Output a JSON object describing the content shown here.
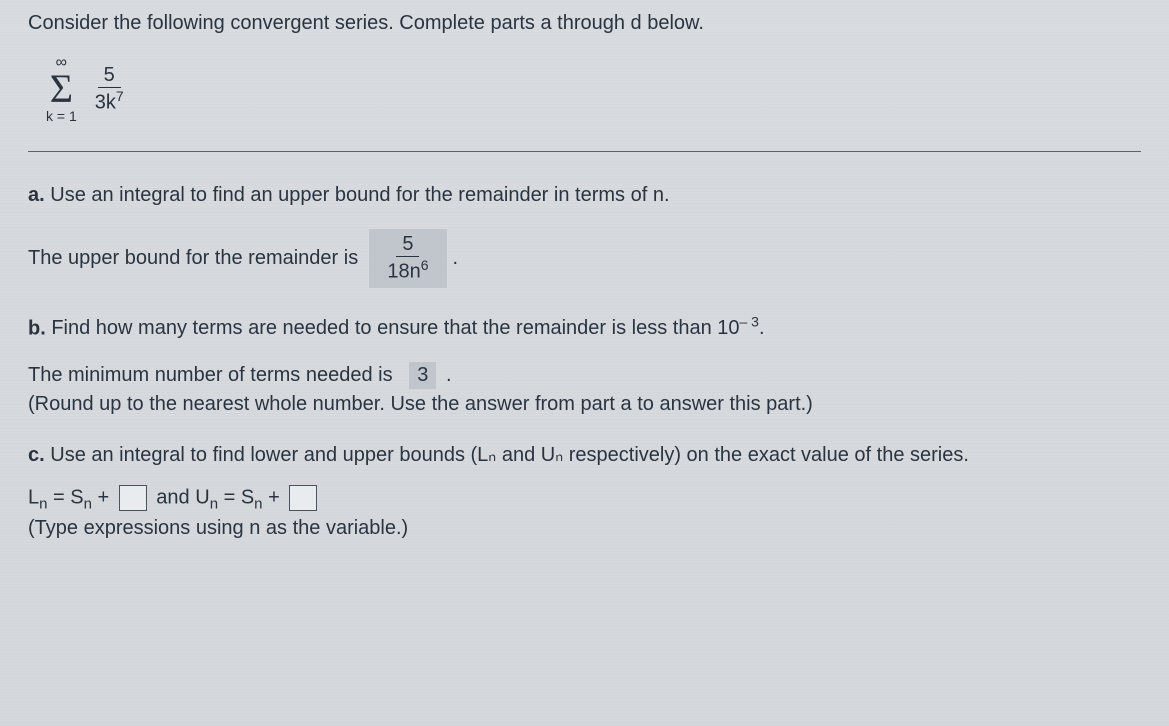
{
  "instruction": "Consider the following convergent series. Complete parts a through d below.",
  "series": {
    "upper": "∞",
    "lower": "k = 1",
    "num": "5",
    "den_base": "3k",
    "den_exp": "7"
  },
  "partA": {
    "label": "a.",
    "prompt": "Use an integral to find an upper bound for the remainder in terms of n.",
    "answer_prefix": "The upper bound for the remainder is",
    "frac_num": "5",
    "frac_den_base": "18n",
    "frac_den_exp": "6",
    "suffix": "."
  },
  "partB": {
    "label": "b.",
    "prompt_prefix": "Find how many terms are needed to ensure that the remainder is less than 10",
    "prompt_exp": "– 3",
    "prompt_suffix": ".",
    "answer_prefix": "The minimum number of terms needed is",
    "answer_value": "3",
    "answer_suffix": ".",
    "hint": "(Round up to the nearest whole number. Use the answer from part a to answer this part.)"
  },
  "partC": {
    "label": "c.",
    "prompt": "Use an integral to find lower and upper bounds (Lₙ and Uₙ respectively) on the exact value of the series.",
    "eq_L": "L",
    "eq_S": "S",
    "eq_U": "U",
    "sub_n": "n",
    "eq_eq": " = ",
    "eq_plus": " + ",
    "eq_and": " and ",
    "hint": "(Type expressions using n as the variable.)"
  }
}
